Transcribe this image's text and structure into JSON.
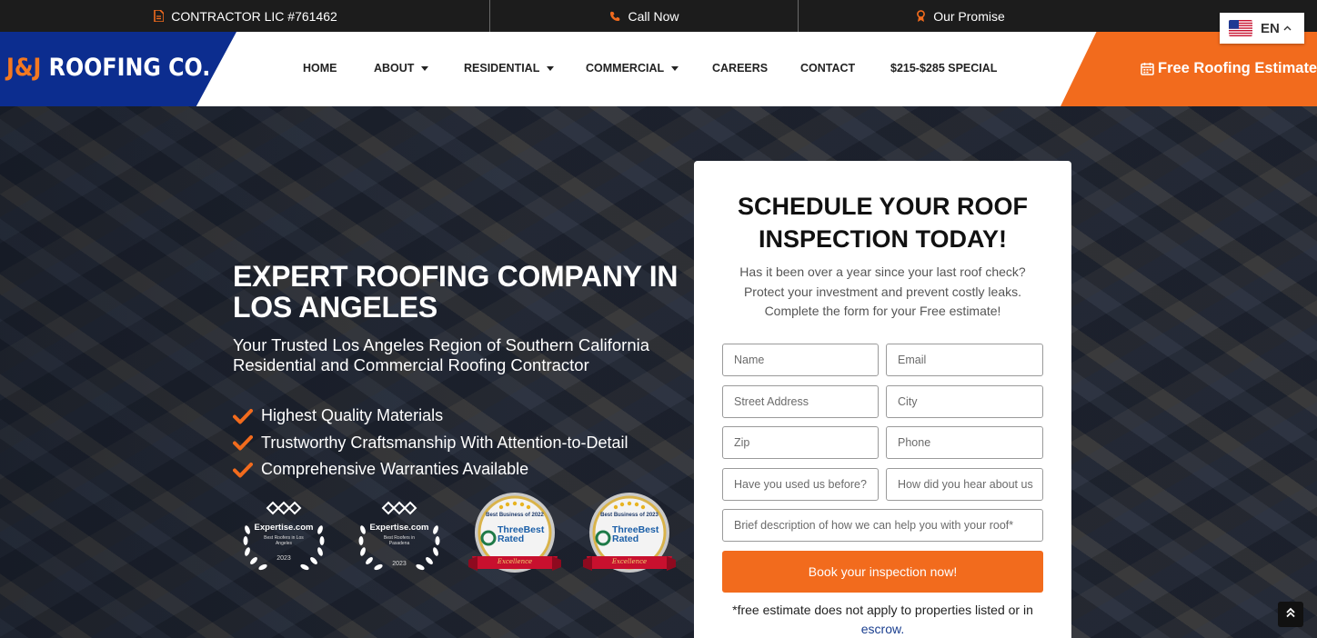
{
  "topbar": {
    "license": "CONTRACTOR LIC #761462",
    "call": "Call Now",
    "promise": "Our Promise"
  },
  "language": {
    "code": "EN",
    "flag": "us-flag-icon"
  },
  "header": {
    "logo_text_accent": "J&J",
    "logo_text_main": " ROOFING CO.",
    "nav": [
      {
        "label": "HOME",
        "dropdown": false
      },
      {
        "label": "ABOUT",
        "dropdown": true
      },
      {
        "label": "RESIDENTIAL",
        "dropdown": true
      },
      {
        "label": "COMMERCIAL",
        "dropdown": true
      },
      {
        "label": "CAREERS",
        "dropdown": false
      },
      {
        "label": "CONTACT",
        "dropdown": false
      },
      {
        "label": "$215-$285 SPECIAL",
        "dropdown": false
      }
    ],
    "cta": "Free Roofing Estimate"
  },
  "hero": {
    "title": "EXPERT ROOFING COMPANY IN LOS ANGELES",
    "subtitle": "Your Trusted Los Angeles Region of Southern California Residential and Commercial Roofing Contractor",
    "bullets": [
      "Highest Quality Materials",
      "Trustworthy Craftsmanship With Attention-to-Detail",
      "Comprehensive Warranties Available"
    ],
    "badges": [
      {
        "brand": "Expertise.com",
        "desc": "Best Roofers in Los Angeles",
        "year": "2023"
      },
      {
        "brand": "Expertise.com",
        "desc": "Best Roofers in Pasadena",
        "year": "2023"
      },
      {
        "brand": "ThreeBest Rated",
        "top": "Best Business of 2022",
        "ribbon": "Excellence"
      },
      {
        "brand": "ThreeBest Rated",
        "top": "Best Business of 2023",
        "ribbon": "Excellence"
      }
    ]
  },
  "form": {
    "title": "SCHEDULE YOUR ROOF INSPECTION TODAY!",
    "description": "Has it been over a year since your last roof check? Protect your investment and prevent costly leaks. Complete the form for your Free estimate!",
    "placeholders": {
      "name": "Name",
      "email": "Email",
      "street": "Street Address",
      "city": "City",
      "zip": "Zip",
      "phone": "Phone",
      "used_before": "Have you used us before?",
      "heard_about": "How did you hear about us",
      "description": "Brief description of how we can help you with your roof*"
    },
    "submit": "Book your inspection now!",
    "disclaimer": "*free estimate does not apply to properties listed or in",
    "disclaimer_link": "escrow."
  },
  "colors": {
    "accent_orange": "#f26b1d",
    "brand_blue": "#0c2d8f",
    "topbar_bg": "#1c1c1c"
  }
}
